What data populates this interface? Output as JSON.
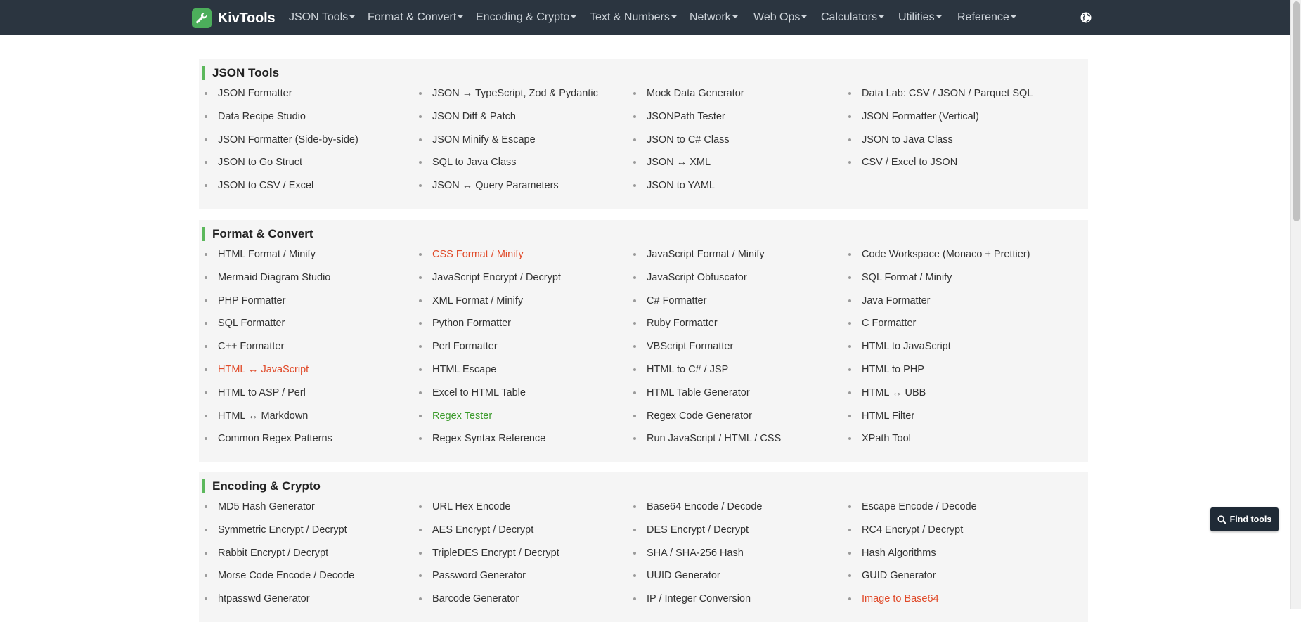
{
  "brand": {
    "name": "KivTools"
  },
  "nav": [
    "JSON Tools",
    "Format & Convert",
    "Encoding & Crypto",
    "Text & Numbers",
    "Network",
    "Web Ops",
    "Calculators",
    "Utilities",
    "Reference"
  ],
  "find_tools": {
    "label": "Find tools"
  },
  "colors": {
    "accent": "#5cb85c",
    "navbar": "#2b3540",
    "highlight_red": "#e04a29",
    "highlight_green": "#3a9a2a"
  },
  "sections": [
    {
      "title": "JSON Tools",
      "items": [
        [
          "JSON Formatter",
          "JSON → TypeScript, Zod & Pydantic",
          "Mock Data Generator",
          "Data Lab: CSV / JSON / Parquet SQL"
        ],
        [
          "Data Recipe Studio",
          "JSON Diff & Patch",
          "JSONPath Tester",
          " JSON Formatter (Vertical)"
        ],
        [
          "JSON Formatter (Side-by-side)",
          "JSON Minify & Escape",
          "JSON to C# Class",
          " JSON to Java Class"
        ],
        [
          "JSON to Go Struct",
          "SQL to Java Class",
          "JSON ↔ XML",
          "CSV / Excel to JSON"
        ],
        [
          "JSON to CSV / Excel",
          "JSON ↔ Query Parameters",
          "JSON to YAML",
          ""
        ]
      ]
    },
    {
      "title": "Format & Convert",
      "items": [
        [
          "HTML Format / Minify",
          " CSS Format / Minify",
          "JavaScript Format / Minify",
          "Code Workspace (Monaco + Prettier)"
        ],
        [
          "Mermaid Diagram Studio",
          "JavaScript Encrypt / Decrypt",
          " JavaScript Obfuscator",
          "SQL Format / Minify"
        ],
        [
          "PHP Formatter",
          "XML Format / Minify",
          "C# Formatter",
          "Java Formatter"
        ],
        [
          "SQL Formatter",
          "Python Formatter",
          "Ruby Formatter",
          "C Formatter"
        ],
        [
          "C++ Formatter",
          "Perl Formatter",
          "VBScript Formatter",
          " HTML to JavaScript"
        ],
        [
          "HTML ↔ JavaScript",
          " HTML Escape",
          " HTML to C# / JSP",
          "HTML to PHP"
        ],
        [
          "HTML to ASP / Perl",
          "Excel to HTML Table",
          "HTML Table Generator",
          "HTML ↔ UBB"
        ],
        [
          "HTML ↔ Markdown",
          "Regex Tester",
          "Regex Code Generator",
          "HTML Filter"
        ],
        [
          "Common Regex Patterns",
          "Regex Syntax Reference",
          "Run JavaScript / HTML / CSS",
          "XPath Tool"
        ]
      ]
    },
    {
      "title": "Encoding & Crypto",
      "items": [
        [
          "MD5 Hash Generator",
          "URL Hex Encode",
          " Base64 Encode / Decode",
          "Escape Encode / Decode"
        ],
        [
          "Symmetric Encrypt / Decrypt",
          "AES Encrypt / Decrypt",
          "DES Encrypt / Decrypt",
          "RC4 Encrypt / Decrypt"
        ],
        [
          "Rabbit Encrypt / Decrypt",
          "TripleDES Encrypt / Decrypt",
          "SHA / SHA-256 Hash",
          "Hash Algorithms"
        ],
        [
          "Morse Code Encode / Decode",
          "Password Generator",
          "UUID Generator",
          "GUID Generator"
        ],
        [
          "htpasswd Generator",
          "Barcode Generator",
          "IP / Integer Conversion",
          " Image to Base64"
        ]
      ]
    }
  ]
}
